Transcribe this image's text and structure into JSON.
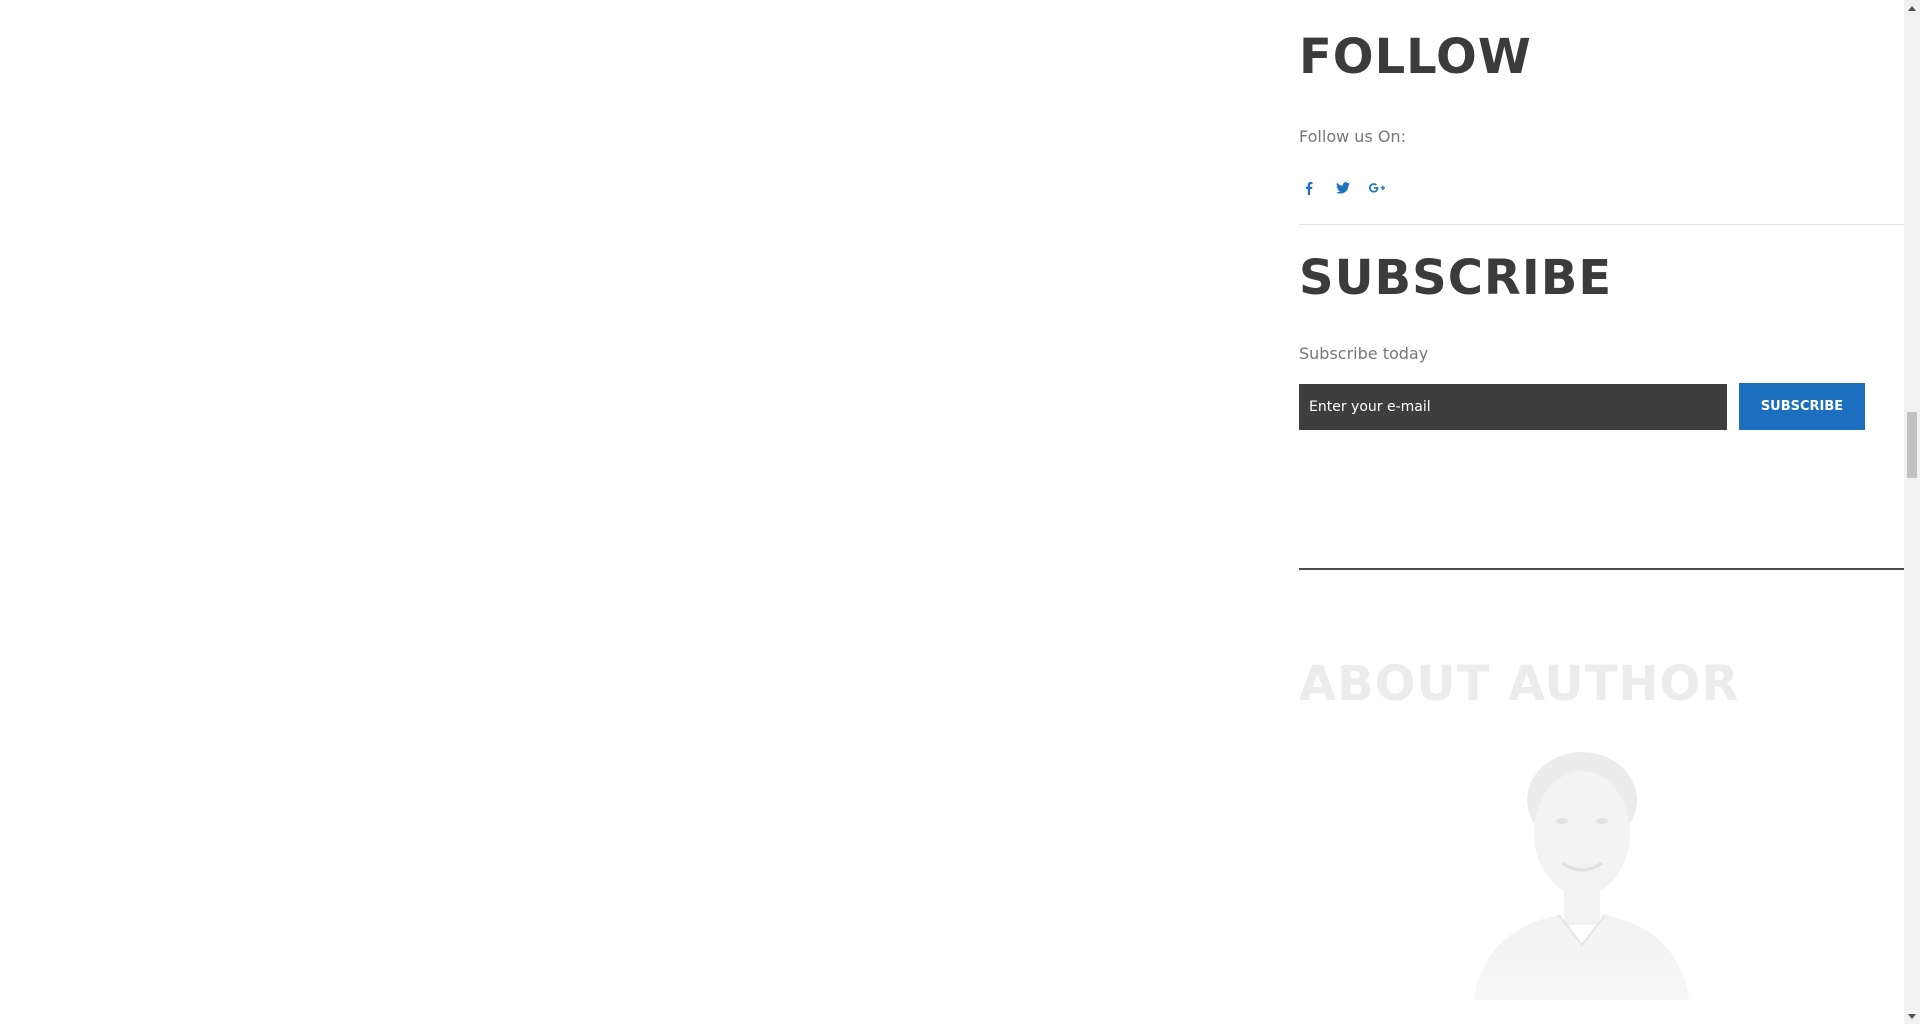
{
  "follow": {
    "title": "FOLLOW",
    "text": "Follow us On:",
    "social": [
      {
        "name": "facebook",
        "glyph": "f",
        "icon": "facebook-icon"
      },
      {
        "name": "twitter",
        "glyph": "🐦",
        "icon": "twitter-icon"
      },
      {
        "name": "google-plus",
        "glyph": "G+",
        "icon": "google-plus-icon"
      }
    ]
  },
  "subscribe": {
    "title": "SUBSCRIBE",
    "text": "Subscribe today",
    "input_placeholder": "Enter your e-mail",
    "button_label": "SUBSCRIBE"
  },
  "about": {
    "title": "ABOUT AUTHOR"
  },
  "colors": {
    "accent": "#1b6fbe",
    "heading": "#3b3b3b",
    "input_bg": "#3e3e3e"
  }
}
